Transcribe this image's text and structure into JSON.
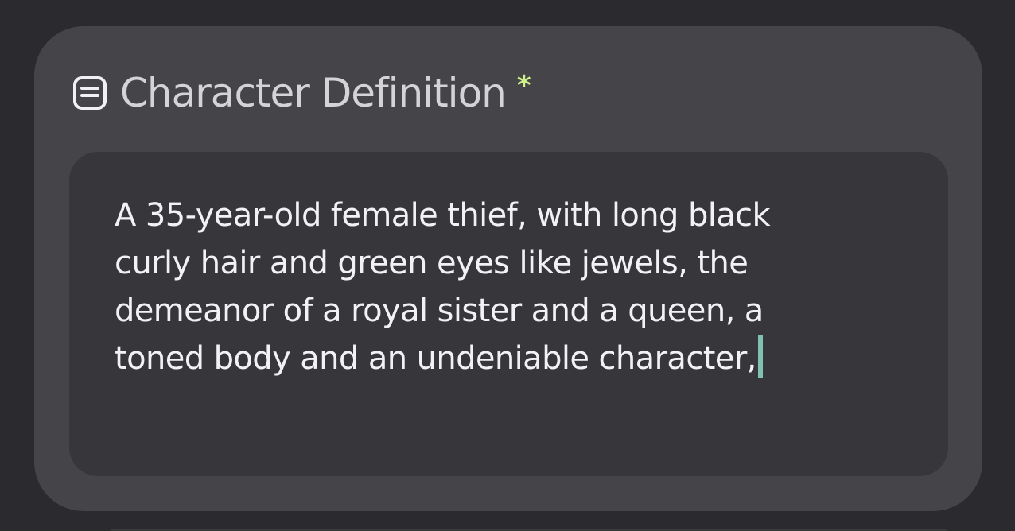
{
  "section": {
    "title": "Character Definition",
    "required_marker": "*",
    "icon": "document-icon"
  },
  "field": {
    "value_lines": [
      "A 35-year-old female thief, with long black",
      "curly hair and green eyes like jewels, the",
      "demeanor of a royal sister and a queen, a",
      "toned body and an undeniable character,"
    ]
  },
  "colors": {
    "page_background": "#2b2a2f",
    "card_background": "#454449",
    "field_background": "#37363b",
    "required_marker": "#cdf08a",
    "caret": "#7fc2b2"
  }
}
